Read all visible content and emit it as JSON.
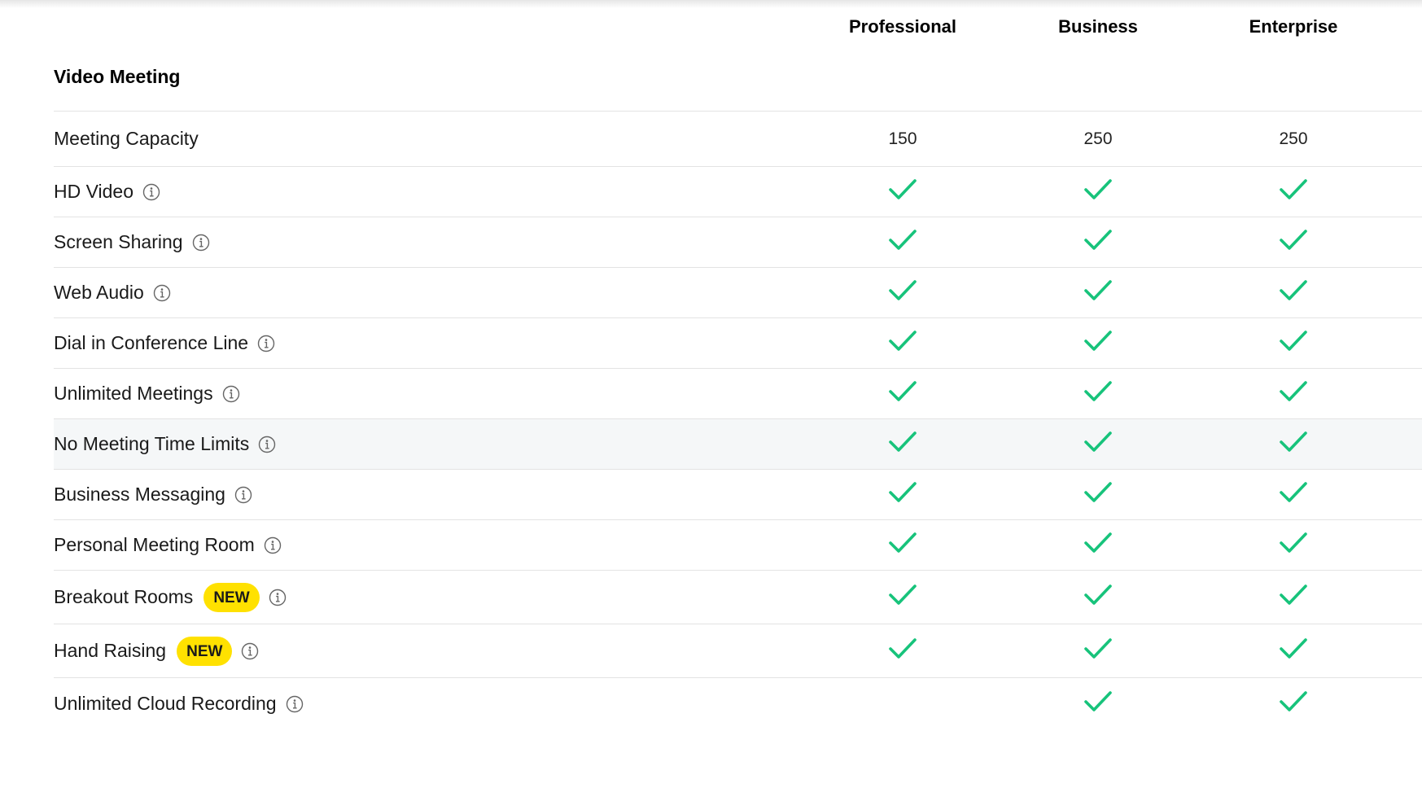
{
  "columns": [
    "Professional",
    "Business",
    "Enterprise"
  ],
  "section_title": "Video Meeting",
  "colors": {
    "check": "#17c37b",
    "badge_bg": "#ffe100",
    "row_highlight": "#f5f7f8",
    "divider": "#e3e3e3"
  },
  "icons": {
    "info": "info-circle-icon",
    "included": "checkmark-icon"
  },
  "rows": [
    {
      "feature": "Meeting Capacity",
      "info": false,
      "badge": "",
      "values": [
        "150",
        "250",
        "250"
      ]
    },
    {
      "feature": "HD Video",
      "info": true,
      "badge": "",
      "values": [
        "check",
        "check",
        "check"
      ]
    },
    {
      "feature": "Screen Sharing",
      "info": true,
      "badge": "",
      "values": [
        "check",
        "check",
        "check"
      ]
    },
    {
      "feature": "Web Audio",
      "info": true,
      "badge": "",
      "values": [
        "check",
        "check",
        "check"
      ]
    },
    {
      "feature": "Dial in Conference Line",
      "info": true,
      "badge": "",
      "values": [
        "check",
        "check",
        "check"
      ]
    },
    {
      "feature": "Unlimited Meetings",
      "info": true,
      "badge": "",
      "values": [
        "check",
        "check",
        "check"
      ]
    },
    {
      "feature": "No Meeting Time Limits",
      "info": true,
      "badge": "",
      "highlighted": true,
      "values": [
        "check",
        "check",
        "check"
      ]
    },
    {
      "feature": "Business Messaging",
      "info": true,
      "badge": "",
      "values": [
        "check",
        "check",
        "check"
      ]
    },
    {
      "feature": "Personal Meeting Room",
      "info": true,
      "badge": "",
      "values": [
        "check",
        "check",
        "check"
      ]
    },
    {
      "feature": "Breakout Rooms",
      "info": true,
      "badge": "NEW",
      "values": [
        "check",
        "check",
        "check"
      ]
    },
    {
      "feature": "Hand Raising",
      "info": true,
      "badge": "NEW",
      "values": [
        "check",
        "check",
        "check"
      ]
    },
    {
      "feature": "Unlimited Cloud Recording",
      "info": true,
      "badge": "",
      "values": [
        "",
        "check",
        "check"
      ]
    }
  ]
}
